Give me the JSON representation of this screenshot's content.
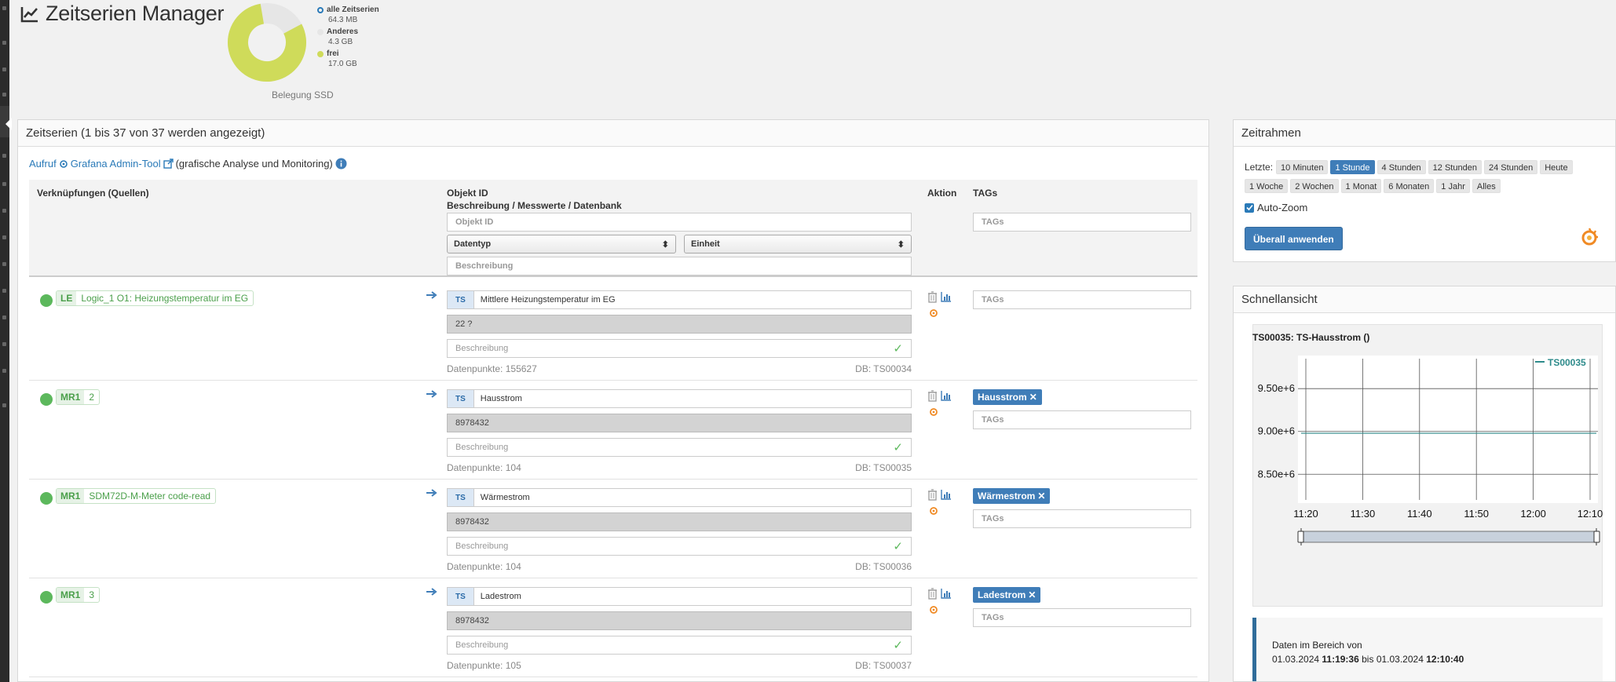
{
  "app": {
    "title": "Zeitserien Manager"
  },
  "storage": {
    "caption": "Belegung SSD",
    "legend": [
      {
        "label": "alle Zeitserien",
        "value": "64.3 MB",
        "color": "#2a7ab8"
      },
      {
        "label": "Anderes",
        "value": "4.3 GB",
        "color": "#e6e6e6"
      },
      {
        "label": "frei",
        "value": "17.0 GB",
        "color": "#cfdb5a"
      }
    ]
  },
  "main": {
    "header": "Zeitserien (1 bis 37 von 37 werden angezeigt)",
    "grafana_call": "Aufruf",
    "grafana_link": "Grafana Admin-Tool",
    "grafana_note": "(grafische Analyse und Monitoring)",
    "columns": {
      "sources": "Verknüpfungen (Quellen)",
      "object_id": "Objekt ID",
      "desc": "Beschreibung / Messwerte / Datenbank",
      "action": "Aktion",
      "tags": "TAGs"
    },
    "filters": {
      "object_id": "Objekt ID",
      "datatype": "Datentyp",
      "unit": "Einheit",
      "description": "Beschreibung",
      "tags": "TAGs"
    },
    "rows": [
      {
        "source_key": "LE",
        "source_name": "Logic_1 O1: Heizungstemperatur im EG",
        "ts_prefix": "TS",
        "name": "Mittlere Heizungstemperatur im EG",
        "value": "22 ?",
        "desc_placeholder": "Beschreibung",
        "datapoints": "Datenpunkte: 155627",
        "db": "DB: TS00034",
        "tag": "",
        "tags_placeholder": "TAGs"
      },
      {
        "source_key": "MR1",
        "source_name": "2",
        "ts_prefix": "TS",
        "name": "Hausstrom",
        "value": "8978432",
        "desc_placeholder": "Beschreibung",
        "datapoints": "Datenpunkte: 104",
        "db": "DB: TS00035",
        "tag": "Hausstrom",
        "tags_placeholder": "TAGs"
      },
      {
        "source_key": "MR1",
        "source_name": "SDM72D-M-Meter code-read",
        "ts_prefix": "TS",
        "name": "Wärmestrom",
        "value": "8978432",
        "desc_placeholder": "Beschreibung",
        "datapoints": "Datenpunkte: 104",
        "db": "DB: TS00036",
        "tag": "Wärmestrom",
        "tags_placeholder": "TAGs"
      },
      {
        "source_key": "MR1",
        "source_name": "3",
        "ts_prefix": "TS",
        "name": "Ladestrom",
        "value": "8978432",
        "desc_placeholder": "Beschreibung",
        "datapoints": "Datenpunkte: 105",
        "db": "DB: TS00037",
        "tag": "Ladestrom",
        "tags_placeholder": "TAGs"
      }
    ]
  },
  "zeitrahmen": {
    "header": "Zeitrahmen",
    "label": "Letzte:",
    "options": [
      "10 Minuten",
      "1 Stunde",
      "4 Stunden",
      "12 Stunden",
      "24 Stunden",
      "Heute",
      "1 Woche",
      "2 Wochen",
      "1 Monat",
      "6 Monaten",
      "1 Jahr",
      "Alles"
    ],
    "active": "1 Stunde",
    "autozoom": "Auto-Zoom",
    "apply": "Überall anwenden"
  },
  "schnellansicht": {
    "header": "Schnellansicht",
    "chart_title": "TS00035: TS-Hausstrom ()",
    "info_line1": "Daten im Bereich von",
    "from_date": "01.03.2024",
    "from_time": "11:19:36",
    "bis": "bis",
    "to_date": "01.03.2024",
    "to_time": "12:10:40"
  },
  "chart_data": {
    "type": "line",
    "series": [
      {
        "name": "TS00035",
        "x": [
          "11:19:36",
          "11:30",
          "11:40",
          "11:50",
          "12:00",
          "12:10:40"
        ],
        "values": [
          8978432,
          8978432,
          8978432,
          8978432,
          8978432,
          8978432
        ],
        "color": "#2e8b8b"
      }
    ],
    "x_ticks": [
      "11:20",
      "11:30",
      "11:40",
      "11:50",
      "12:00",
      "12:10"
    ],
    "y_ticks": [
      "9.50e+6",
      "9.00e+6",
      "8.50e+6"
    ],
    "y_tick_values": [
      9500000,
      9000000,
      8500000
    ],
    "ylim": [
      8200000,
      9850000
    ],
    "legend": "top-right",
    "grid": true
  }
}
